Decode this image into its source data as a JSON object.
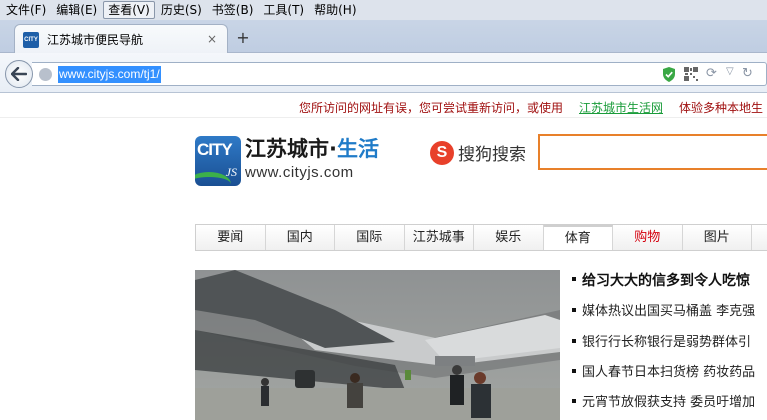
{
  "menu": [
    "文件(F)",
    "编辑(E)",
    "查看(V)",
    "历史(S)",
    "书签(B)",
    "工具(T)",
    "帮助(H)"
  ],
  "tab": {
    "title": "江苏城市便民导航",
    "favicon_label": "CITY",
    "close": "×",
    "new_tab": "+"
  },
  "urlbar": {
    "url": "www.cityjs.com/tj1/"
  },
  "notice": {
    "text": "您所访问的网址有误，您可尝试重新访问，或使用",
    "link": "江苏城市生活网",
    "tail": "体验多种本地生"
  },
  "logo": {
    "mark_text": "CITY",
    "mark_sub": "JS",
    "name_main": "江苏城市·",
    "name_accent": "生活",
    "url": "www.cityjs.com"
  },
  "search": {
    "brand_icon": "S",
    "brand": "搜狗搜索",
    "placeholder": ""
  },
  "categories": [
    {
      "label": "要闻",
      "state": ""
    },
    {
      "label": "国内",
      "state": ""
    },
    {
      "label": "国际",
      "state": ""
    },
    {
      "label": "江苏城事",
      "state": ""
    },
    {
      "label": "娱乐",
      "state": ""
    },
    {
      "label": "体育",
      "state": "active"
    },
    {
      "label": "购物",
      "state": "hot"
    },
    {
      "label": "图片",
      "state": ""
    }
  ],
  "headlines": {
    "lead": "给习大大的信多到令人吃惊",
    "items": [
      "媒体热议出国买马桶盖 李克强",
      "银行行长称银行是弱势群体引",
      "国人春节日本扫货榜 药妆药品",
      "元宵节放假获支持 委员吁增加"
    ]
  },
  "colors": {
    "accent_orange": "#e8802a",
    "notice_red": "#a01010",
    "link_green": "#1a9c3a",
    "url_highlight": "#3390ff"
  }
}
